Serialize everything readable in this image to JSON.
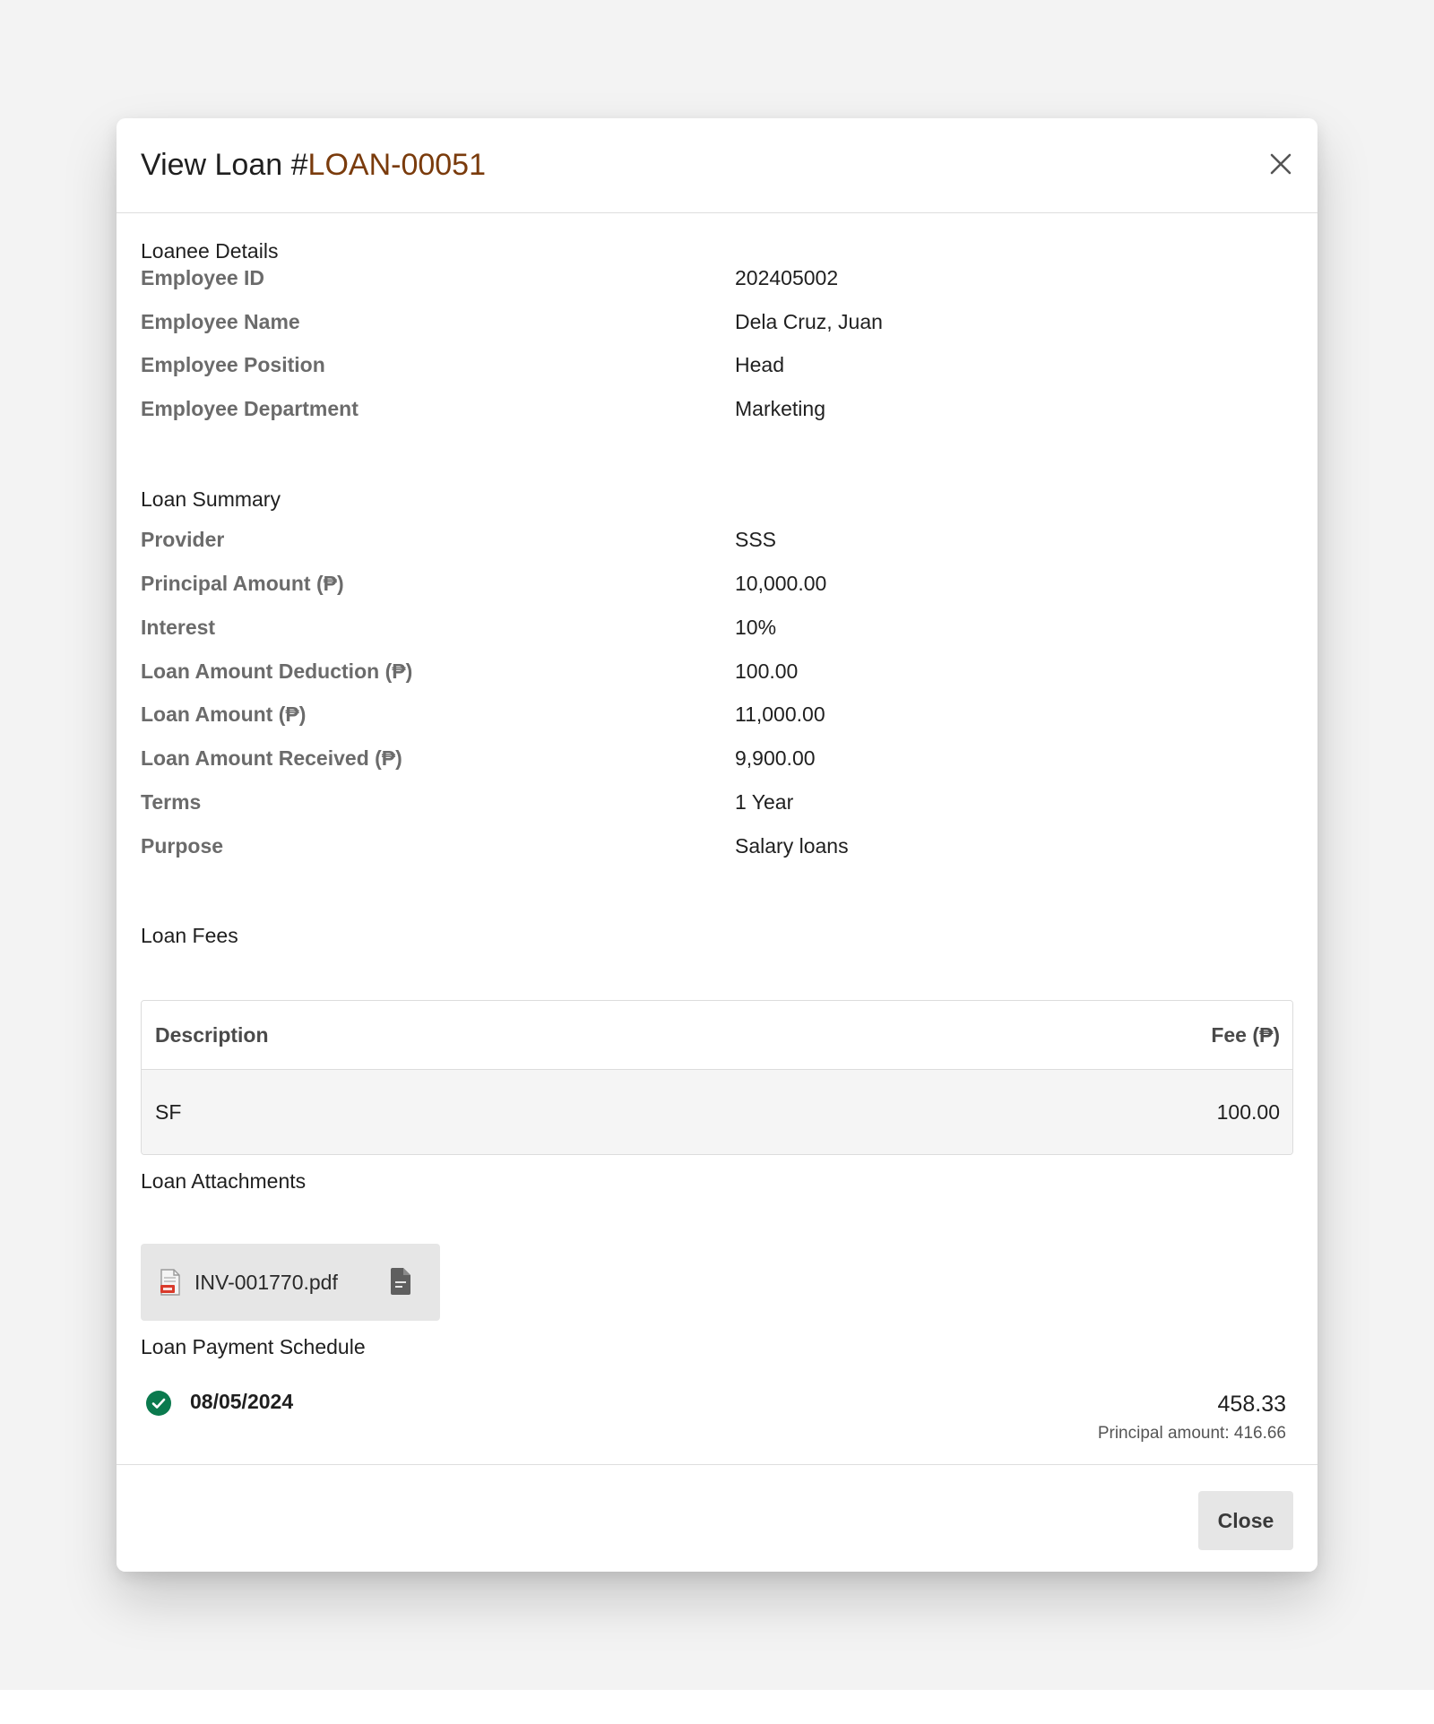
{
  "modal": {
    "title_prefix": "View Loan #",
    "loan_id": "LOAN-00051",
    "close_icon": "close-icon",
    "close_button_label": "Close"
  },
  "loanee_details": {
    "title": "Loanee Details",
    "fields": [
      {
        "label": "Employee ID",
        "value": "202405002"
      },
      {
        "label": "Employee Name",
        "value": "Dela Cruz, Juan"
      },
      {
        "label": "Employee Position",
        "value": "Head"
      },
      {
        "label": "Employee Department",
        "value": "Marketing"
      }
    ]
  },
  "loan_summary": {
    "title": "Loan Summary",
    "fields": [
      {
        "label": "Provider",
        "value": "SSS"
      },
      {
        "label": "Principal Amount (₱)",
        "value": "10,000.00"
      },
      {
        "label": "Interest",
        "value": "10%"
      },
      {
        "label": "Loan Amount Deduction (₱)",
        "value": "100.00"
      },
      {
        "label": "Loan Amount (₱)",
        "value": "11,000.00"
      },
      {
        "label": "Loan Amount Received (₱)",
        "value": "9,900.00"
      },
      {
        "label": "Terms",
        "value": "1 Year"
      },
      {
        "label": "Purpose",
        "value": "Salary loans"
      }
    ]
  },
  "loan_fees": {
    "title": "Loan Fees",
    "columns": [
      "Description",
      "Fee (₱)"
    ],
    "rows": [
      {
        "description": "SF",
        "fee": "100.00"
      }
    ]
  },
  "loan_attachments": {
    "title": "Loan Attachments",
    "files": [
      {
        "name": "INV-001770.pdf",
        "file_icon": "pdf-file-icon",
        "action_icon": "document-icon"
      }
    ]
  },
  "payment_schedule": {
    "title": "Loan Payment Schedule",
    "items": [
      {
        "date": "08/05/2024",
        "amount": "458.33",
        "principal": "Principal amount: 416.66",
        "status_icon": "check-circle-icon"
      }
    ]
  },
  "colors": {
    "loan_id": "#7a3b0c",
    "paid_status": "#0b7a4e",
    "pdf_badge": "#d93a2b"
  }
}
